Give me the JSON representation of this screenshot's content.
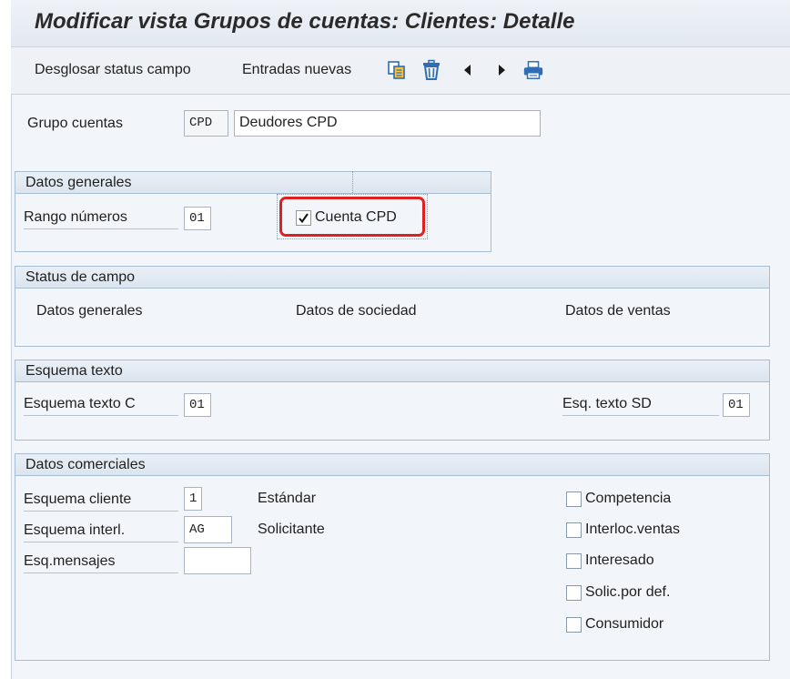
{
  "header": {
    "title": "Modificar vista Grupos de cuentas: Clientes: Detalle"
  },
  "toolbar": {
    "breakdown_label": "Desglosar status campo",
    "new_entries_label": "Entradas nuevas",
    "icons": [
      "copy-icon",
      "delete-icon",
      "previous-icon",
      "next-icon",
      "print-icon"
    ]
  },
  "account_group": {
    "label": "Grupo cuentas",
    "code": "CPD",
    "description": "Deudores CPD"
  },
  "general_data": {
    "title": "Datos generales",
    "number_range_label": "Rango números",
    "number_range_value": "01",
    "one_time_account_label": "Cuenta CPD",
    "one_time_account_checked": true
  },
  "field_status": {
    "title": "Status de campo",
    "general_label": "Datos generales",
    "company_label": "Datos de sociedad",
    "sales_label": "Datos de ventas"
  },
  "text_scheme": {
    "title": "Esquema texto",
    "scheme_c_label": "Esquema texto C",
    "scheme_c_value": "01",
    "scheme_sd_label": "Esq. texto SD",
    "scheme_sd_value": "01"
  },
  "commercial_data": {
    "title": "Datos comerciales",
    "customer_scheme_label": "Esquema cliente",
    "customer_scheme_value": "1",
    "customer_scheme_text": "Estándar",
    "partner_scheme_label": "Esquema interl.",
    "partner_scheme_value": "AG",
    "partner_scheme_text": "Solicitante",
    "messages_scheme_label": "Esq.mensajes",
    "messages_scheme_value": "",
    "checkboxes": [
      {
        "label": "Competencia",
        "checked": false
      },
      {
        "label": "Interloc.ventas",
        "checked": false
      },
      {
        "label": "Interesado",
        "checked": false
      },
      {
        "label": "Solic.por def.",
        "checked": false
      },
      {
        "label": "Consumidor",
        "checked": false
      }
    ]
  },
  "colors": {
    "highlight": "#e02020",
    "group_border": "#a9bdd2",
    "icon_blue": "#2f6db5"
  }
}
